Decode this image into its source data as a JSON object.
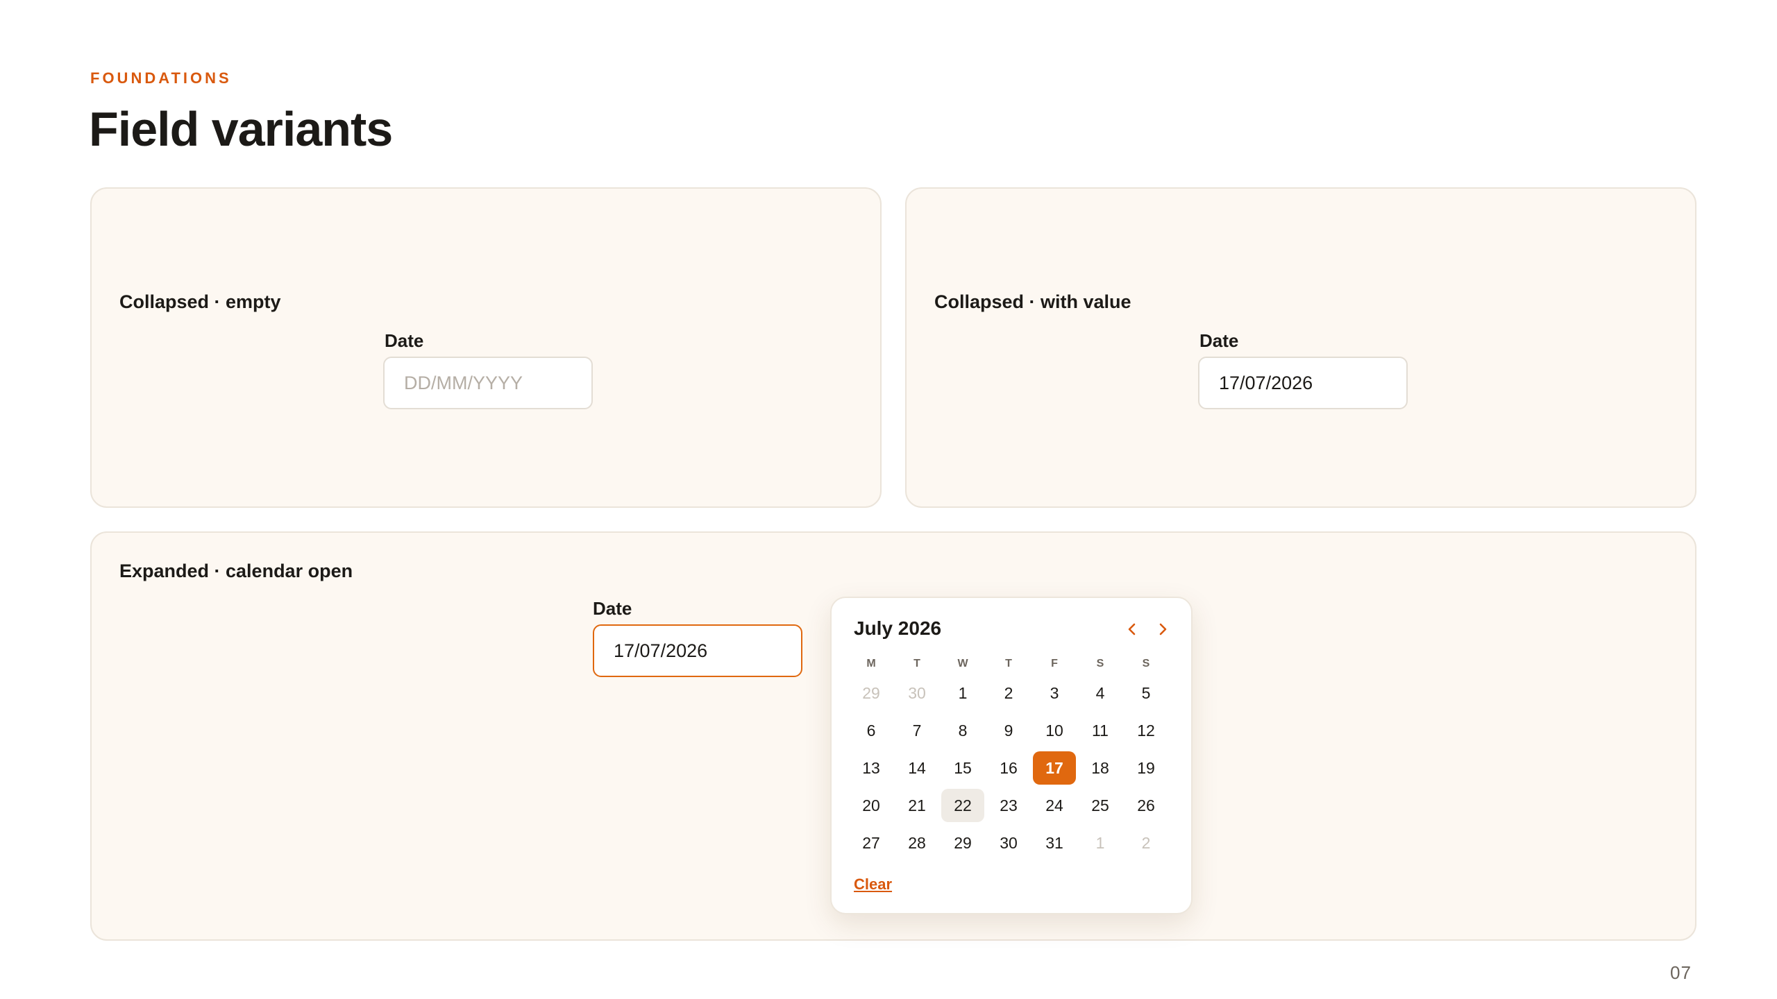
{
  "header": {
    "eyebrow": "FOUNDATIONS",
    "title": "Field variants"
  },
  "panels": {
    "empty": {
      "label": "Collapsed · empty",
      "field_label": "Date",
      "value": "",
      "placeholder": "DD/MM/YYYY"
    },
    "with_value": {
      "label": "Collapsed · with value",
      "field_label": "Date",
      "value": "17/07/2026"
    },
    "open": {
      "label": "Expanded · calendar open",
      "field_label": "Date",
      "value": "17/07/2026"
    }
  },
  "calendar": {
    "month_label": "July 2026",
    "prev_icon": "chevron-left-icon",
    "next_icon": "chevron-right-icon",
    "weekdays": [
      "M",
      "T",
      "W",
      "T",
      "F",
      "S",
      "S"
    ],
    "weeks": [
      [
        {
          "d": "29",
          "out": true
        },
        {
          "d": "30",
          "out": true
        },
        {
          "d": "1"
        },
        {
          "d": "2"
        },
        {
          "d": "3"
        },
        {
          "d": "4"
        },
        {
          "d": "5"
        }
      ],
      [
        {
          "d": "6"
        },
        {
          "d": "7"
        },
        {
          "d": "8"
        },
        {
          "d": "9"
        },
        {
          "d": "10"
        },
        {
          "d": "11"
        },
        {
          "d": "12"
        }
      ],
      [
        {
          "d": "13"
        },
        {
          "d": "14"
        },
        {
          "d": "15"
        },
        {
          "d": "16"
        },
        {
          "d": "17",
          "selected": true
        },
        {
          "d": "18"
        },
        {
          "d": "19"
        }
      ],
      [
        {
          "d": "20"
        },
        {
          "d": "21"
        },
        {
          "d": "22",
          "hover": true
        },
        {
          "d": "23"
        },
        {
          "d": "24"
        },
        {
          "d": "25"
        },
        {
          "d": "26"
        }
      ],
      [
        {
          "d": "27"
        },
        {
          "d": "28"
        },
        {
          "d": "29"
        },
        {
          "d": "30"
        },
        {
          "d": "31"
        },
        {
          "d": "1",
          "out": true
        },
        {
          "d": "2",
          "out": true
        }
      ]
    ],
    "clear_label": "Clear"
  },
  "page_number": "07",
  "colors": {
    "accent": "#e0680f",
    "panel_background": "#fdf8f2",
    "text": "#1c1a17"
  }
}
